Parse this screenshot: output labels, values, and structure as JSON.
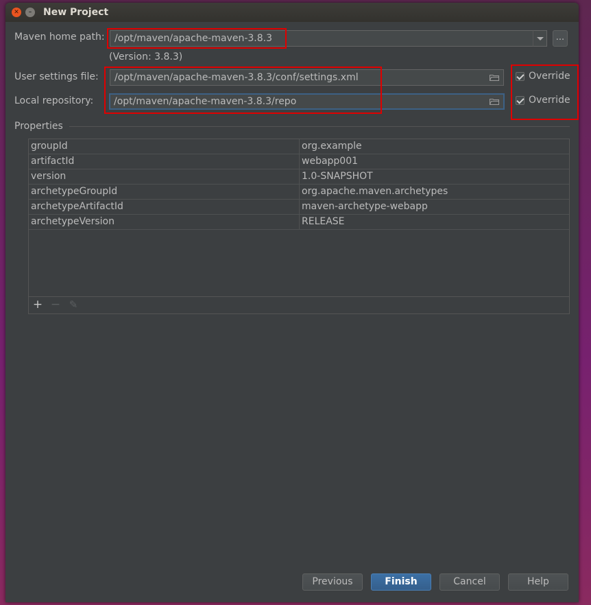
{
  "window": {
    "title": "New Project"
  },
  "maven_home": {
    "label": "Maven home path:",
    "value": "/opt/maven/apache-maven-3.8.3",
    "version_note": "(Version: 3.8.3)",
    "ellipsis_label": "..."
  },
  "user_settings": {
    "label": "User settings file:",
    "value": "/opt/maven/apache-maven-3.8.3/conf/settings.xml",
    "override_label": "Override",
    "override_checked": true
  },
  "local_repo": {
    "label": "Local repository:",
    "value": "/opt/maven/apache-maven-3.8.3/repo",
    "override_label": "Override",
    "override_checked": true
  },
  "properties": {
    "title": "Properties",
    "rows": [
      {
        "key": "groupId",
        "value": "org.example"
      },
      {
        "key": "artifactId",
        "value": "webapp001"
      },
      {
        "key": "version",
        "value": "1.0-SNAPSHOT"
      },
      {
        "key": "archetypeGroupId",
        "value": "org.apache.maven.archetypes"
      },
      {
        "key": "archetypeArtifactId",
        "value": "maven-archetype-webapp"
      },
      {
        "key": "archetypeVersion",
        "value": "RELEASE"
      }
    ],
    "toolbar": {
      "add": "+",
      "remove": "−",
      "edit": "✎"
    }
  },
  "buttons": {
    "previous": "Previous",
    "finish": "Finish",
    "cancel": "Cancel",
    "help": "Help"
  },
  "colors": {
    "background": "#3c3f41",
    "field": "#45494a",
    "accent": "#365f8b",
    "highlight": "#e00000"
  }
}
